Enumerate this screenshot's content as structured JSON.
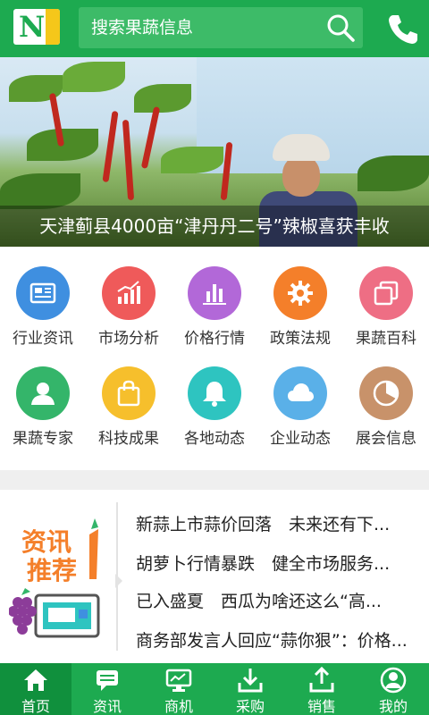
{
  "header": {
    "logo_letter": "N",
    "search_placeholder": "搜索果蔬信息",
    "icons": [
      "logo",
      "search-icon",
      "phone-icon"
    ]
  },
  "banner": {
    "caption": "天津蓟县4000亩“津丹丹二号”辣椒喜获丰收"
  },
  "categories": [
    {
      "label": "行业资讯",
      "icon": "newspaper-icon",
      "color": "#3f8fe0"
    },
    {
      "label": "市场分析",
      "icon": "trend-chart-icon",
      "color": "#ef5a5a"
    },
    {
      "label": "价格行情",
      "icon": "bar-chart-icon",
      "color": "#b268d8"
    },
    {
      "label": "政策法规",
      "icon": "gear-icon",
      "color": "#f47f2a"
    },
    {
      "label": "果蔬百科",
      "icon": "copy-icon",
      "color": "#ee6e84"
    },
    {
      "label": "果蔬专家",
      "icon": "user-icon",
      "color": "#34b56a"
    },
    {
      "label": "科技成果",
      "icon": "bag-icon",
      "color": "#f6bf2c"
    },
    {
      "label": "各地动态",
      "icon": "bell-icon",
      "color": "#2ec4c0"
    },
    {
      "label": "企业动态",
      "icon": "cloud-icon",
      "color": "#5ab0e8"
    },
    {
      "label": "展会信息",
      "icon": "pie-chart-icon",
      "color": "#c8926a"
    }
  ],
  "news": {
    "badge_text": [
      "资讯",
      "推荐"
    ],
    "items": [
      "新蒜上市蒜价回落　未来还有下...",
      "胡萝卜行情暴跌　健全市场服务...",
      "已入盛夏　西瓜为啥还这么“高...",
      "商务部发言人回应“蒜你狠”：价格..."
    ]
  },
  "nav": {
    "tabs": [
      {
        "label": "首页",
        "icon": "home-icon",
        "active": true
      },
      {
        "label": "资讯",
        "icon": "message-icon",
        "active": false
      },
      {
        "label": "商机",
        "icon": "monitor-icon",
        "active": false
      },
      {
        "label": "采购",
        "icon": "download-icon",
        "active": false
      },
      {
        "label": "销售",
        "icon": "upload-icon",
        "active": false
      },
      {
        "label": "我的",
        "icon": "profile-icon",
        "active": false
      }
    ]
  },
  "colors": {
    "brand": "#1daa50",
    "brand_dark": "#10903d"
  }
}
